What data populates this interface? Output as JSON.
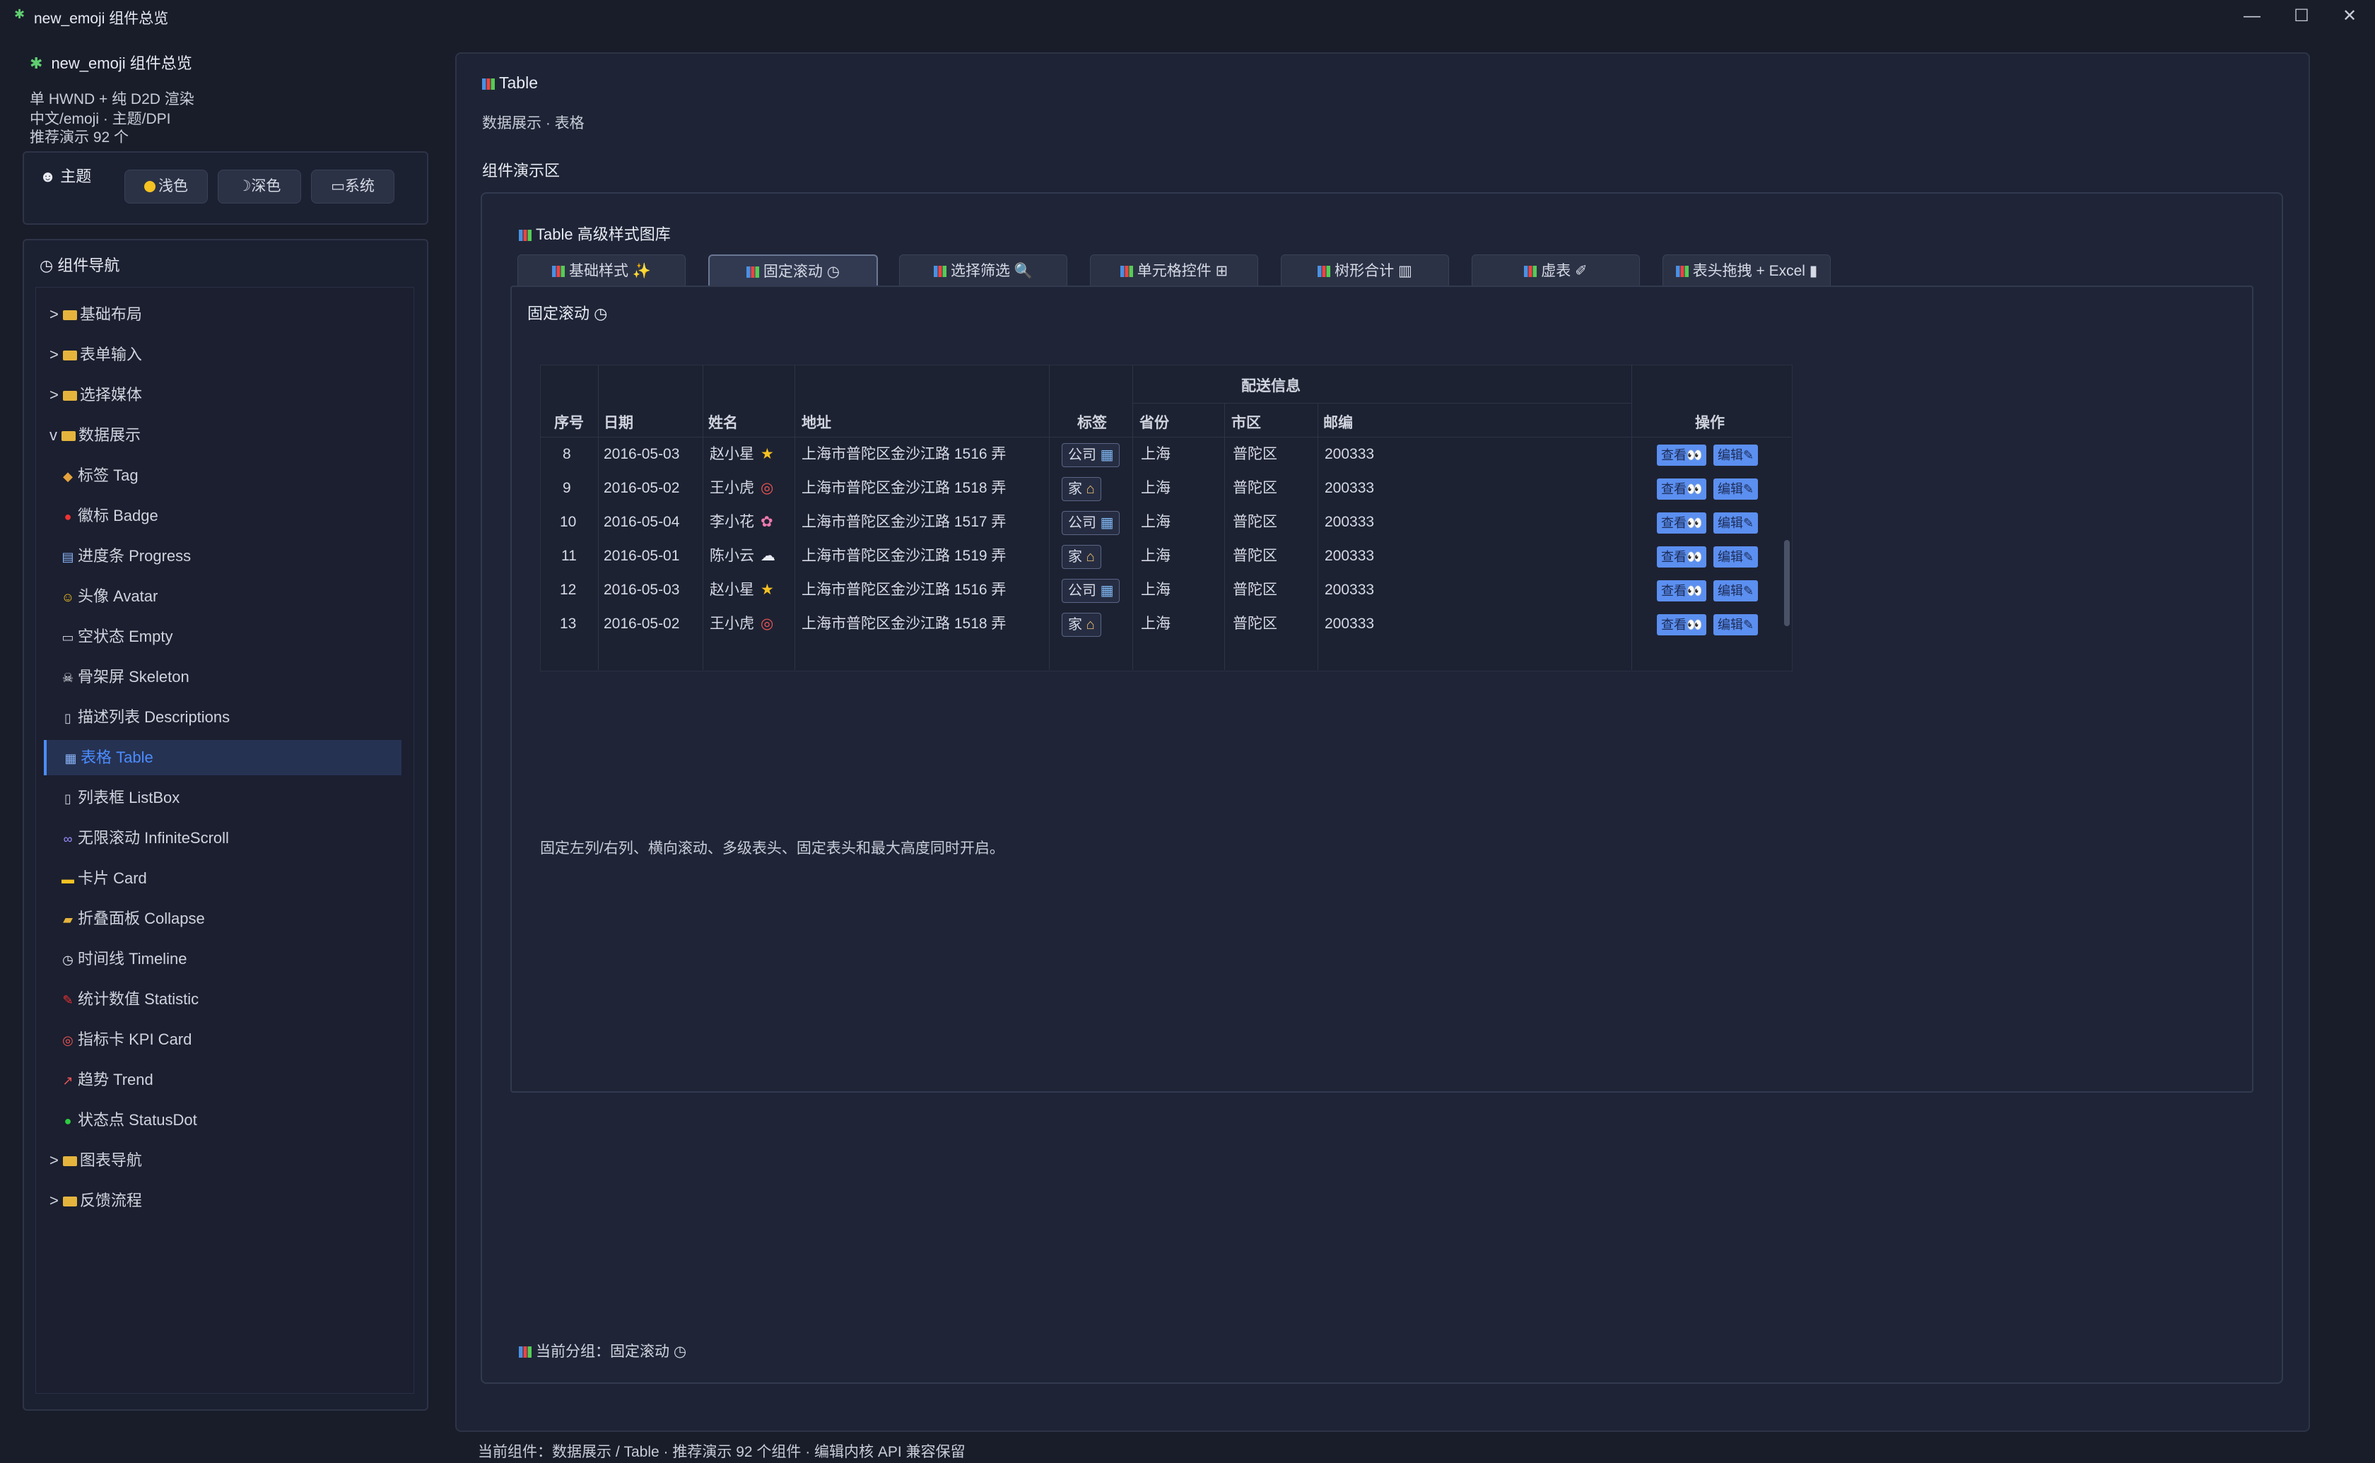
{
  "window": {
    "title": "new_emoji 组件总览",
    "icon": "sparkle-icon"
  },
  "sidebar": {
    "app_title": "new_emoji 组件总览",
    "info": [
      "单 HWND + 纯 D2D 渲染",
      "中文/emoji · 主题/DPI",
      "推荐演示 92 个"
    ],
    "theme": {
      "label": "主题",
      "light": "浅色",
      "dark": "深色",
      "system": "系统"
    },
    "nav_title": "组件导航",
    "groups_top": [
      {
        "label": "基础布局",
        "prefix": ">"
      },
      {
        "label": "表单输入",
        "prefix": ">"
      },
      {
        "label": "选择媒体",
        "prefix": ">"
      },
      {
        "label": "数据展示",
        "prefix": "v"
      }
    ],
    "leaves": [
      {
        "label": "标签 Tag",
        "icon": "◆"
      },
      {
        "label": "徽标 Badge",
        "icon": "●"
      },
      {
        "label": "进度条 Progress",
        "icon": "▤"
      },
      {
        "label": "头像 Avatar",
        "icon": "☺"
      },
      {
        "label": "空状态 Empty",
        "icon": "▭"
      },
      {
        "label": "骨架屏 Skeleton",
        "icon": "☠"
      },
      {
        "label": "描述列表 Descriptions",
        "icon": "▯"
      },
      {
        "label": "表格 Table",
        "icon": "▦",
        "active": true
      },
      {
        "label": "列表框 ListBox",
        "icon": "▯"
      },
      {
        "label": "无限滚动 InfiniteScroll",
        "icon": "∞"
      },
      {
        "label": "卡片 Card",
        "icon": "▬"
      },
      {
        "label": "折叠面板 Collapse",
        "icon": "▰"
      },
      {
        "label": "时间线 Timeline",
        "icon": "◷"
      },
      {
        "label": "统计数值 Statistic",
        "icon": "✎"
      },
      {
        "label": "指标卡 KPI Card",
        "icon": "◎"
      },
      {
        "label": "趋势 Trend",
        "icon": "↗"
      },
      {
        "label": "状态点 StatusDot",
        "icon": "●"
      }
    ],
    "groups_bottom": [
      {
        "label": "图表导航",
        "prefix": ">"
      },
      {
        "label": "反馈流程",
        "prefix": ">"
      }
    ]
  },
  "main": {
    "title": "Table",
    "subtitle": "数据展示 · 表格",
    "demo_label": "组件演示区",
    "gallery_title": "Table 高级样式图库",
    "tabs": [
      {
        "label": "基础样式 ✨"
      },
      {
        "label": "固定滚动 ◷",
        "active": true
      },
      {
        "label": "选择筛选 🔍"
      },
      {
        "label": "单元格控件 ⊞"
      },
      {
        "label": "树形合计 ▥"
      },
      {
        "label": "虚表 ✐"
      },
      {
        "label": "表头拖拽 + Excel ▮"
      }
    ],
    "group_label": "固定滚动 ◷",
    "table": {
      "group_header": "配送信息",
      "columns": [
        "序号",
        "日期",
        "姓名",
        "地址",
        "标签",
        "省份",
        "市区",
        "邮编",
        "操作"
      ],
      "rows": [
        {
          "no": "8",
          "date": "2016-05-03",
          "name": "赵小星",
          "emoji": "★",
          "addr": "上海市普陀区金沙江路 1516 弄",
          "tag": "公司",
          "tag_icon": "▦",
          "prov": "上海",
          "city": "普陀区",
          "zip": "200333"
        },
        {
          "no": "9",
          "date": "2016-05-02",
          "name": "王小虎",
          "emoji": "◎",
          "addr": "上海市普陀区金沙江路 1518 弄",
          "tag": "家",
          "tag_icon": "⌂",
          "prov": "上海",
          "city": "普陀区",
          "zip": "200333"
        },
        {
          "no": "10",
          "date": "2016-05-04",
          "name": "李小花",
          "emoji": "✿",
          "addr": "上海市普陀区金沙江路 1517 弄",
          "tag": "公司",
          "tag_icon": "▦",
          "prov": "上海",
          "city": "普陀区",
          "zip": "200333"
        },
        {
          "no": "11",
          "date": "2016-05-01",
          "name": "陈小云",
          "emoji": "☁",
          "addr": "上海市普陀区金沙江路 1519 弄",
          "tag": "家",
          "tag_icon": "⌂",
          "prov": "上海",
          "city": "普陀区",
          "zip": "200333"
        },
        {
          "no": "12",
          "date": "2016-05-03",
          "name": "赵小星",
          "emoji": "★",
          "addr": "上海市普陀区金沙江路 1516 弄",
          "tag": "公司",
          "tag_icon": "▦",
          "prov": "上海",
          "city": "普陀区",
          "zip": "200333"
        },
        {
          "no": "13",
          "date": "2016-05-02",
          "name": "王小虎",
          "emoji": "◎",
          "addr": "上海市普陀区金沙江路 1518 弄",
          "tag": "家",
          "tag_icon": "⌂",
          "prov": "上海",
          "city": "普陀区",
          "zip": "200333"
        }
      ],
      "view_label": "查看",
      "edit_label": "编辑"
    },
    "description": "固定左列/右列、横向滚动、多级表头、固定表头和最大高度同时开启。",
    "current_group": "当前分组：固定滚动 ◷"
  },
  "status_bar": "当前组件：数据展示 / Table · 推荐演示 92 个组件 · 编辑内核 API 兼容保留",
  "colors": {
    "accent": "#4b8cff",
    "background": "#191d2a",
    "button": "#5b8ff0"
  }
}
